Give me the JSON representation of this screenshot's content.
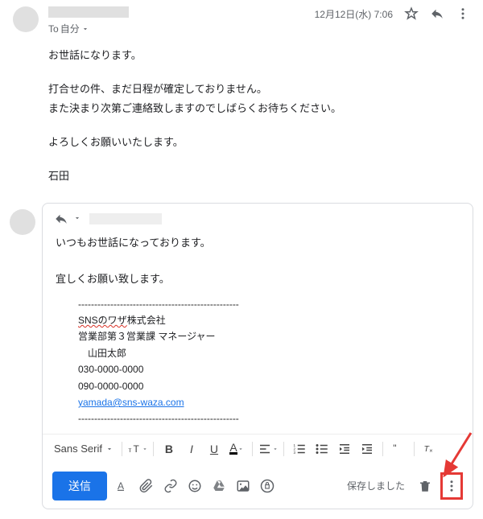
{
  "header": {
    "recipient_prefix": "To",
    "recipient": "自分",
    "timestamp": "12月12日(水) 7:06"
  },
  "email": {
    "greeting": "お世話になります。",
    "line2": "打合せの件、まだ日程が確定しておりません。",
    "line3": "また決まり次第ご連絡致しますのでしばらくお待ちください。",
    "closing": "よろしくお願いいたします。",
    "sign": "石田"
  },
  "compose": {
    "line1": "いつもお世話になっております。",
    "line2": "宜しくお願い致します。",
    "sep": "--------------------------------------------------",
    "sig_company_u": "SNSのワザ",
    "sig_company_tail": "株式会社",
    "sig_dept": "営業部第３営業課 マネージャー",
    "sig_name": "山田太郎",
    "sig_tel": "030-0000-0000",
    "sig_mobile": "090-0000-0000",
    "sig_email": "yamada@sns-waza.com"
  },
  "toolbar": {
    "font": "Sans Serif"
  },
  "sendbar": {
    "send": "送信",
    "saved": "保存しました"
  }
}
